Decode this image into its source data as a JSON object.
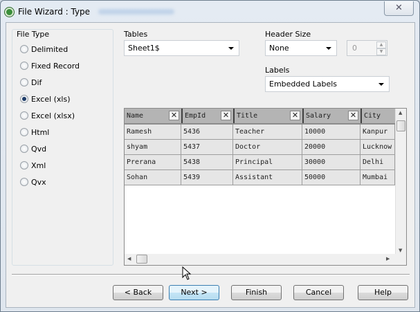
{
  "window": {
    "title": "File Wizard : Type",
    "close_label": "✕"
  },
  "file_type": {
    "label": "File Type",
    "options": [
      {
        "label": "Delimited",
        "selected": false
      },
      {
        "label": "Fixed Record",
        "selected": false
      },
      {
        "label": "Dif",
        "selected": false
      },
      {
        "label": "Excel (xls)",
        "selected": true
      },
      {
        "label": "Excel (xlsx)",
        "selected": false
      },
      {
        "label": "Html",
        "selected": false
      },
      {
        "label": "Qvd",
        "selected": false
      },
      {
        "label": "Xml",
        "selected": false
      },
      {
        "label": "Qvx",
        "selected": false
      }
    ]
  },
  "tables": {
    "label": "Tables",
    "value": "Sheet1$"
  },
  "header_size": {
    "label": "Header Size",
    "value": "None",
    "spin_value": "0"
  },
  "labels": {
    "label": "Labels",
    "value": "Embedded Labels"
  },
  "grid": {
    "columns": [
      "Name",
      "EmpId",
      "Title",
      "Salary",
      "City"
    ],
    "rows": [
      [
        "Ramesh",
        "5436",
        "Teacher",
        "10000",
        "Kanpur"
      ],
      [
        "shyam",
        "5437",
        "Doctor",
        "20000",
        "Lucknow"
      ],
      [
        "Prerana",
        "5438",
        "Principal",
        "30000",
        "Delhi"
      ],
      [
        "Sohan",
        "5439",
        "Assistant",
        "50000",
        "Mumbai"
      ]
    ]
  },
  "buttons": {
    "back": "< Back",
    "next": "Next >",
    "finish": "Finish",
    "cancel": "Cancel",
    "help": "Help"
  }
}
